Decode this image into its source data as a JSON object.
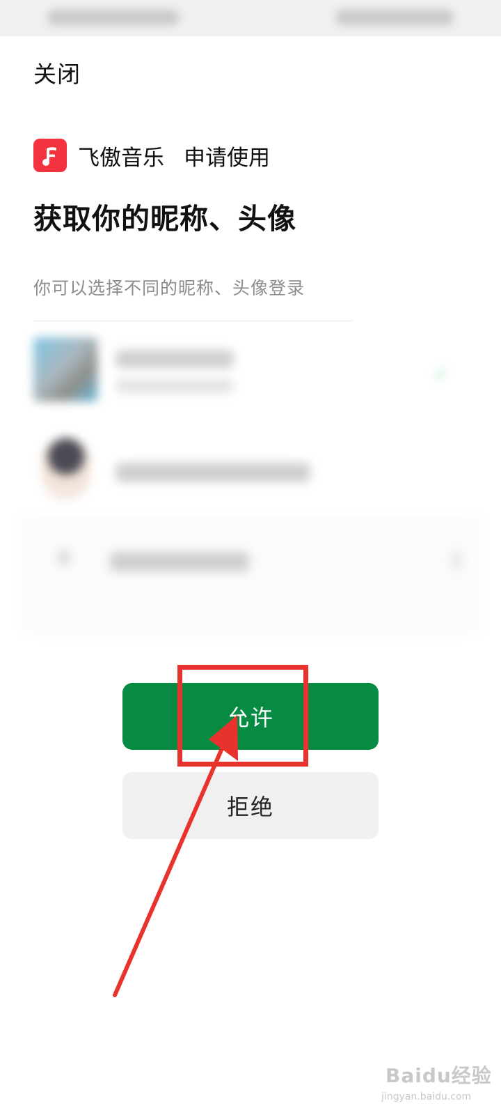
{
  "header": {
    "close_label": "关闭"
  },
  "app": {
    "name": "飞傲音乐",
    "request_text": "申请使用",
    "logo_icon": "music-note-icon",
    "logo_color": "#f2333f"
  },
  "permission": {
    "title": "获取你的昵称、头像",
    "subtitle": "你可以选择不同的昵称、头像登录"
  },
  "actions": {
    "allow_label": "允许",
    "deny_label": "拒绝",
    "allow_color": "#078b43"
  },
  "annotation": {
    "color": "#e8322d"
  },
  "watermark": {
    "brand": "Baidu经验",
    "url": "jingyan.baidu.com"
  }
}
